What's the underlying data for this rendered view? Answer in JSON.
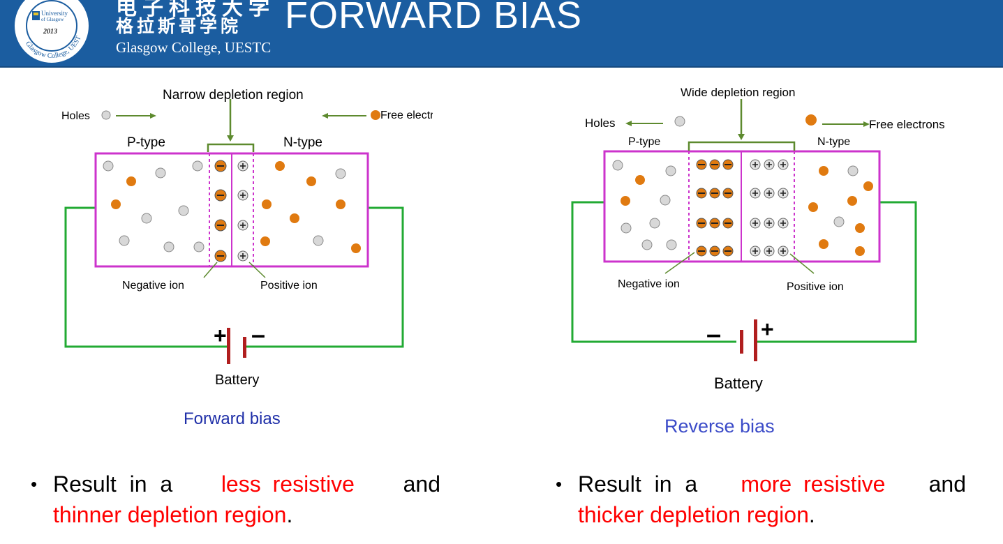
{
  "header": {
    "title": "FORWARD BIAS",
    "college_cn_top": "电子科技大学",
    "college_cn": "格拉斯哥学院",
    "college_en": "Glasgow College, UESTC",
    "logo": {
      "ring_text": "Glasgow College, UESTC",
      "badge_line1": "University",
      "badge_line2": "of Glasgow",
      "year": "2013"
    },
    "color": "#1b5da0"
  },
  "forward_diagram": {
    "top_label": "Narrow depletion region",
    "holes_label": "Holes",
    "electrons_label": "Free electrons",
    "p_label": "P-type",
    "n_label": "N-type",
    "negative_ion_label": "Negative ion",
    "positive_ion_label": "Positive ion",
    "battery_plus": "+",
    "battery_minus": "–",
    "battery_label": "Battery",
    "caption": "Forward bias"
  },
  "reverse_diagram": {
    "top_label": "Wide depletion region",
    "holes_label": "Holes",
    "electrons_label": "Free electrons",
    "p_label": "P-type",
    "n_label": "N-type",
    "negative_ion_label": "Negative ion",
    "positive_ion_label": "Positive ion",
    "battery_plus": "+",
    "battery_minus": "–",
    "battery_label": "Battery",
    "caption": "Reverse bias"
  },
  "bullets": [
    {
      "marker": "•",
      "pre": "Result in a ",
      "red1": "less resistive",
      "mid": " and",
      "red2": "thinner depletion region",
      "post": "."
    },
    {
      "marker": "•",
      "pre": "Result in a ",
      "red1": "more resistive",
      "mid": " and",
      "red2": "thicker depletion region",
      "post": "."
    }
  ],
  "colors": {
    "junction_box": "#cc33cc",
    "wire": "#22aa33",
    "arrow": "#5d8a2e",
    "electron": "#e07a10",
    "hole": "#d8d8d8",
    "battery_plate": "#b01e1e",
    "caption": "#1f2fa8",
    "highlight": "#ff0000"
  }
}
